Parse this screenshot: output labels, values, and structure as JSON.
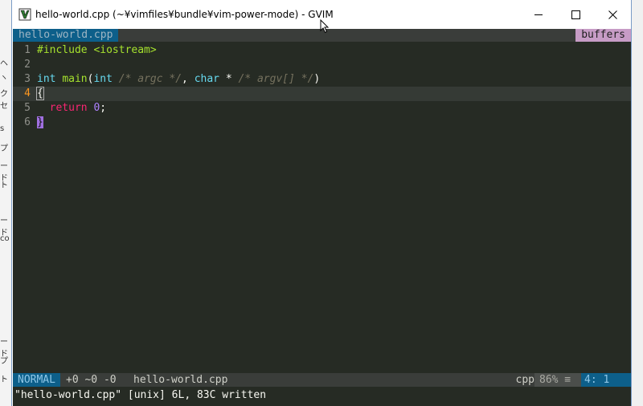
{
  "window": {
    "title": "hello-world.cpp (~¥vimfiles¥bundle¥vim-power-mode) - GVIM"
  },
  "tabline": {
    "active_tab": "hello-world.cpp",
    "right_label": "buffers"
  },
  "editor": {
    "lines": [
      {
        "num": "1",
        "parts": [
          {
            "t": "#include <iostream>",
            "c": "pp"
          }
        ]
      },
      {
        "num": "2",
        "parts": []
      },
      {
        "num": "3",
        "parts": [
          {
            "t": "int",
            "c": "kw"
          },
          {
            "t": " ",
            "c": "txt"
          },
          {
            "t": "main",
            "c": "fn"
          },
          {
            "t": "(",
            "c": "txt"
          },
          {
            "t": "int",
            "c": "kw"
          },
          {
            "t": " ",
            "c": "txt"
          },
          {
            "t": "/* argc */",
            "c": "cm"
          },
          {
            "t": ", ",
            "c": "txt"
          },
          {
            "t": "char",
            "c": "kw"
          },
          {
            "t": " * ",
            "c": "txt"
          },
          {
            "t": "/* argv[] */",
            "c": "cm"
          },
          {
            "t": ")",
            "c": "txt"
          }
        ]
      },
      {
        "num": "4",
        "current": true,
        "parts": [
          {
            "t": "{",
            "c": "brace-cur"
          }
        ]
      },
      {
        "num": "5",
        "parts": [
          {
            "t": "  ",
            "c": "txt"
          },
          {
            "t": "return",
            "c": "ret"
          },
          {
            "t": " ",
            "c": "txt"
          },
          {
            "t": "0",
            "c": "num"
          },
          {
            "t": ";",
            "c": "txt"
          }
        ]
      },
      {
        "num": "6",
        "parts": [
          {
            "t": "}",
            "c": "brace-hl"
          }
        ]
      }
    ]
  },
  "statusline": {
    "mode": "NORMAL",
    "hunks": "+0 ~0 -0",
    "filename": "hello-world.cpp",
    "filetype": "cpp",
    "percent": "86% ≡",
    "position": "4:  1"
  },
  "cmdline": {
    "message": "\"hello-world.cpp\" [unix] 6L, 83C written"
  },
  "background": {
    "left_strip_chars": [
      "ヘ",
      "ヽ",
      "クセ",
      "s",
      "プ",
      "ード",
      "ト",
      "ード",
      "co",
      "ード",
      "プ",
      "ト"
    ]
  },
  "colors": {
    "editor_bg": "#262b24",
    "accent_blue": "#0d5f8a",
    "buffers_pink": "#c79cc6",
    "line_number": "#8f908a",
    "current_line_number": "#fd971f"
  }
}
